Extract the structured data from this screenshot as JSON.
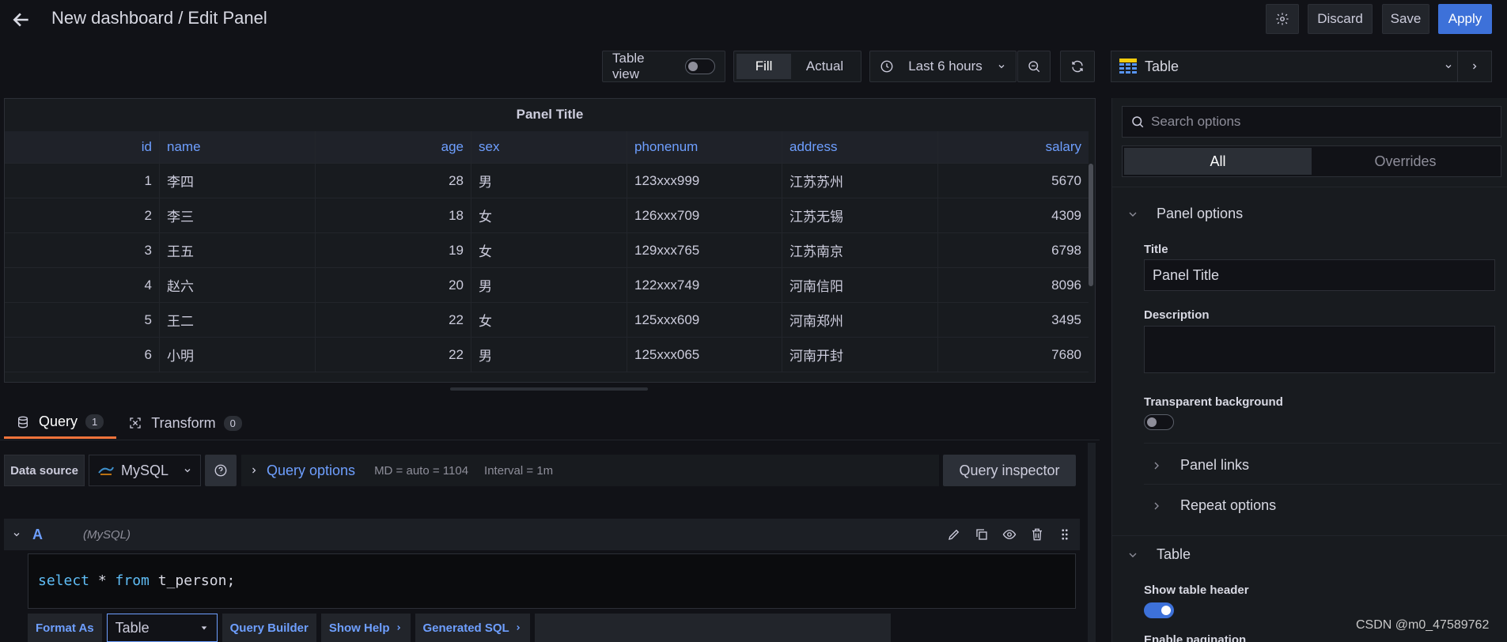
{
  "header": {
    "title": "New dashboard / Edit Panel",
    "discard_label": "Discard",
    "save_label": "Save",
    "apply_label": "Apply"
  },
  "toolbar": {
    "table_view_label": "Table view",
    "table_view_on": false,
    "fill_label": "Fill",
    "actual_label": "Actual",
    "time_range_label": "Last 6 hours"
  },
  "panel": {
    "title": "Panel Title",
    "columns": [
      "id",
      "name",
      "age",
      "sex",
      "phonenum",
      "address",
      "salary"
    ],
    "rows": [
      [
        "1",
        "李四",
        "28",
        "男",
        "123xxx999",
        "江苏苏州",
        "5670"
      ],
      [
        "2",
        "李三",
        "18",
        "女",
        "126xxx709",
        "江苏无锡",
        "4309"
      ],
      [
        "3",
        "王五",
        "19",
        "女",
        "129xxx765",
        "江苏南京",
        "6798"
      ],
      [
        "4",
        "赵六",
        "20",
        "男",
        "122xxx749",
        "河南信阳",
        "8096"
      ],
      [
        "5",
        "王二",
        "22",
        "女",
        "125xxx609",
        "河南郑州",
        "3495"
      ],
      [
        "6",
        "小明",
        "22",
        "男",
        "125xxx065",
        "河南开封",
        "7680"
      ]
    ]
  },
  "query_tabs": {
    "query_label": "Query",
    "query_count": "1",
    "transform_label": "Transform",
    "transform_count": "0"
  },
  "query": {
    "data_source_label": "Data source",
    "data_source_value": "MySQL",
    "query_options_label": "Query options",
    "md_text": "MD = auto = 1104",
    "interval_text": "Interval = 1m",
    "query_inspector_label": "Query inspector",
    "ref_id": "A",
    "ref_ds": "(MySQL)",
    "sql": {
      "kw1": "select",
      "mid": " * ",
      "kw2": "from",
      "rest": " t_person;"
    },
    "format_as_label": "Format As",
    "format_as_value": "Table",
    "query_builder_label": "Query Builder",
    "show_help_label": "Show Help",
    "generated_sql_label": "Generated SQL"
  },
  "options": {
    "viz_name": "Table",
    "search_placeholder": "Search options",
    "tab_all": "All",
    "tab_overrides": "Overrides",
    "panel_options_label": "Panel options",
    "title_label": "Title",
    "title_value": "Panel Title",
    "description_label": "Description",
    "transparent_label": "Transparent background",
    "transparent_on": false,
    "panel_links_label": "Panel links",
    "repeat_options_label": "Repeat options",
    "table_section_label": "Table",
    "show_header_label": "Show table header",
    "show_header_on": true,
    "enable_pagination_label": "Enable pagination"
  },
  "watermark": "CSDN @m0_47589762"
}
